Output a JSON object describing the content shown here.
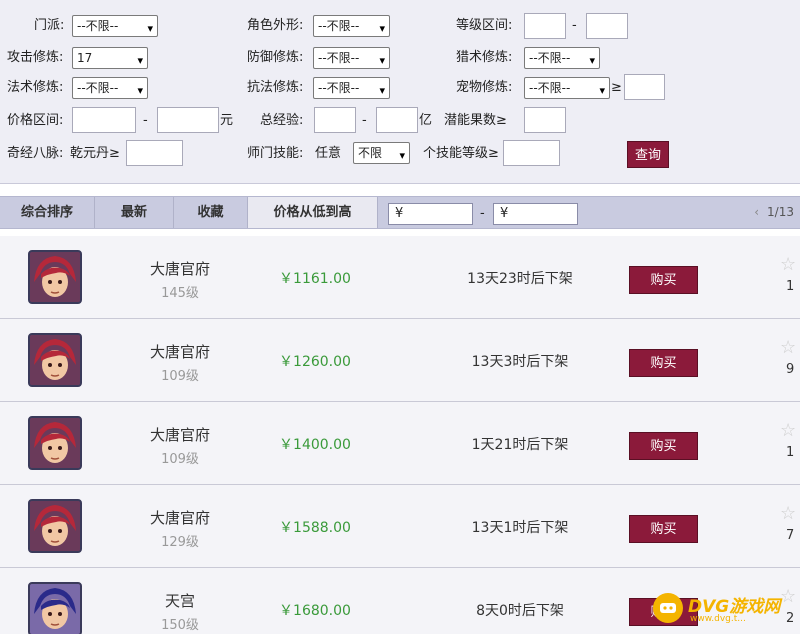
{
  "filters": {
    "sect_label": "门派:",
    "sect_value": "--不限--",
    "appearance_label": "角色外形:",
    "appearance_value": "--不限--",
    "level_range_label": "等级区间:",
    "level_dash": "-",
    "attack_label": "攻击修炼:",
    "attack_value": "17",
    "defense_label": "防御修炼:",
    "defense_value": "--不限--",
    "hunting_label": "猎术修炼:",
    "hunting_value": "--不限--",
    "magic_label": "法术修炼:",
    "magic_value": "--不限--",
    "resist_label": "抗法修炼:",
    "resist_value": "--不限--",
    "pet_label": "宠物修炼:",
    "pet_value": "--不限--",
    "pet_gte": "≥",
    "price_range_label": "价格区间:",
    "price_dash": "-",
    "price_unit": "元",
    "exp_label": "总经验:",
    "exp_dash": "-",
    "exp_unit": "亿",
    "potential_label": "潜能果数≥",
    "meridian_label": "奇经八脉:",
    "meridian_item": "乾元丹≥",
    "skill_label": "师门技能:",
    "skill_any": "任意",
    "skill_value": "不限",
    "skill_level_label": "个技能等级≥",
    "query_button": "查询"
  },
  "sort_bar": {
    "tabs": [
      "综合排序",
      "最新",
      "收藏",
      "价格从低到高"
    ],
    "active_tab": "价格从低到高",
    "price_from": "¥",
    "price_dash": "-",
    "price_to": "¥",
    "pager_prev": "‹",
    "pager_text": "1/13"
  },
  "listings": [
    {
      "sect": "大唐官府",
      "level": "145级",
      "price": "￥1161.00",
      "time": "13天23时后下架",
      "buy": "购买",
      "fav": "1"
    },
    {
      "sect": "大唐官府",
      "level": "109级",
      "price": "￥1260.00",
      "time": "13天3时后下架",
      "buy": "购买",
      "fav": "9"
    },
    {
      "sect": "大唐官府",
      "level": "109级",
      "price": "￥1400.00",
      "time": "1天21时后下架",
      "buy": "购买",
      "fav": "1"
    },
    {
      "sect": "大唐官府",
      "level": "129级",
      "price": "￥1588.00",
      "time": "13天1时后下架",
      "buy": "购买",
      "fav": "7"
    },
    {
      "sect": "天宫",
      "level": "150级",
      "price": "￥1680.00",
      "time": "8天0时后下架",
      "buy": "购买",
      "fav": "2"
    }
  ],
  "watermark": {
    "text": "DVG游戏网",
    "sub": "www.dvg.t..."
  },
  "colors": {
    "accent": "#8b1a3a",
    "price": "#3a9a3a",
    "panel": "#eeeef5",
    "bar": "#c9cbe0"
  }
}
